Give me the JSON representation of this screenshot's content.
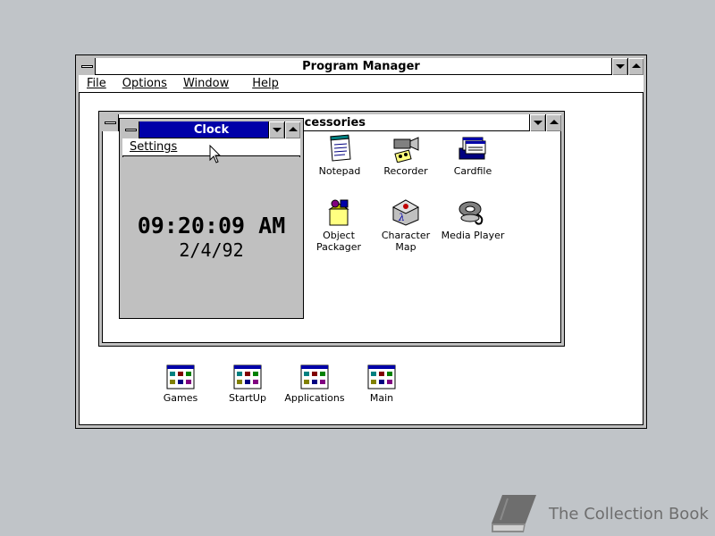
{
  "program_manager": {
    "title": "Program Manager",
    "menu": [
      "File",
      "Options",
      "Window",
      "Help"
    ],
    "group_icons": [
      {
        "label": "Games",
        "icon": "program-group-icon"
      },
      {
        "label": "StartUp",
        "icon": "program-group-icon"
      },
      {
        "label": "Applications",
        "icon": "program-group-icon"
      },
      {
        "label": "Main",
        "icon": "program-group-icon"
      }
    ]
  },
  "accessories": {
    "title": "ccessories",
    "icons": [
      {
        "label": "Notepad",
        "icon": "notepad-icon"
      },
      {
        "label": "Recorder",
        "icon": "recorder-icon"
      },
      {
        "label": "Cardfile",
        "icon": "cardfile-icon"
      },
      {
        "label": "Object Packager",
        "icon": "object-packager-icon"
      },
      {
        "label": "Character Map",
        "icon": "character-map-icon"
      },
      {
        "label": "Media Player",
        "icon": "media-player-icon"
      }
    ]
  },
  "clock": {
    "title": "Clock",
    "menu_settings": "Settings",
    "time": "09:20:09 AM",
    "date": "2/4/92"
  },
  "watermark": {
    "text": "The Collection Book",
    "icon": "book-icon"
  },
  "colors": {
    "desktop": "#c0c4c8",
    "active_title": "#0000a8",
    "window_bg": "#ffffff",
    "face": "#c0c0c0"
  }
}
